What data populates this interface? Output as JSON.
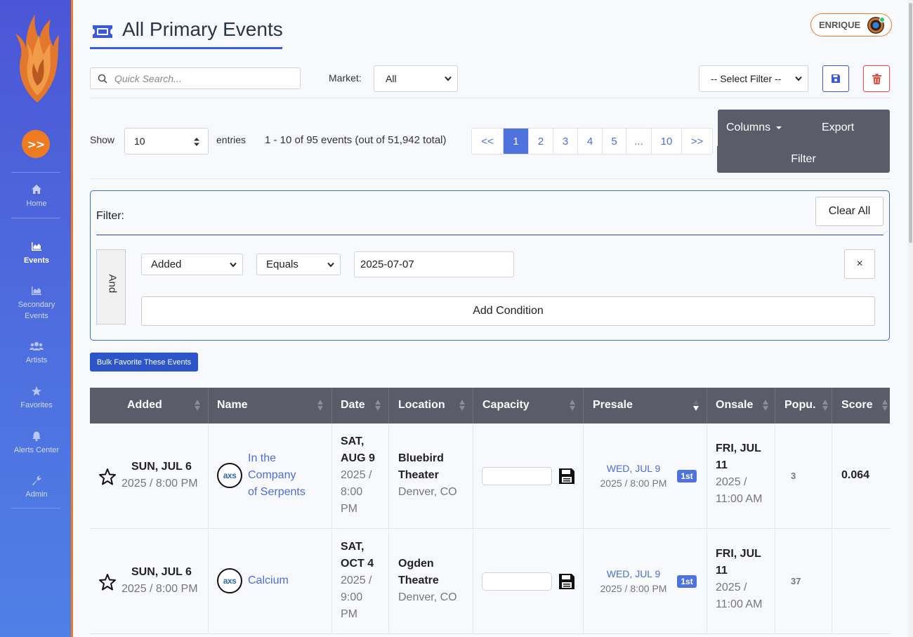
{
  "app": {
    "title": "All Primary Events",
    "user": "ENRIQUE"
  },
  "sidebar": {
    "toggle_glyph": ">>",
    "items": [
      {
        "label": "Home",
        "icon": "home-icon"
      },
      {
        "label": "Events",
        "icon": "chart-area-icon"
      },
      {
        "label": "Secondary Events",
        "icon": "chart-area-icon"
      },
      {
        "label": "Artists",
        "icon": "users-icon"
      },
      {
        "label": "Favorites",
        "icon": "star-icon"
      },
      {
        "label": "Alerts Center",
        "icon": "bell-icon"
      },
      {
        "label": "Admin",
        "icon": "wrench-icon"
      }
    ]
  },
  "toolbar": {
    "search_placeholder": "Quick Search...",
    "market_label": "Market:",
    "market_value": "All",
    "filter_select_value": "-- Select Filter --"
  },
  "listing": {
    "show_label": "Show",
    "entries_value": "10",
    "entries_label": "entries",
    "count_text": "1 - 10 of 95 events (out of 51,942 total)",
    "pages": [
      "<<",
      "1",
      "2",
      "3",
      "4",
      "5",
      "...",
      "10",
      ">>"
    ],
    "active_page": "1",
    "columns_label": "Columns",
    "export_label": "Export",
    "filter_label": "Filter"
  },
  "filter": {
    "title": "Filter:",
    "clear_label": "Clear All",
    "and_label": "And",
    "field_value": "Added",
    "operator_value": "Equals",
    "value": "2025-07-07",
    "remove_label": "×",
    "add_condition_label": "Add Condition"
  },
  "bulk_favorite_label": "Bulk Favorite These Events",
  "table": {
    "headers": [
      "Added",
      "Name",
      "Date",
      "Location",
      "Capacity",
      "Presale",
      "Onsale",
      "Popu.",
      "Score"
    ],
    "rows": [
      {
        "added_day": "SUN, JUL 6",
        "added_time": "2025 / 8:00 PM",
        "logo": "axs",
        "name_lines": [
          "In the",
          "Company",
          "of Serpents"
        ],
        "date_lines": [
          "SAT,",
          "AUG 9"
        ],
        "date_sub_lines": [
          "2025 /",
          "8:00",
          "PM"
        ],
        "location_lines": [
          "Bluebird",
          "Theater"
        ],
        "city": "Denver, CO",
        "presale_day": "WED, JUL 9",
        "presale_time": "2025 / 8:00 PM",
        "presale_badge": "1st",
        "onsale_lines": [
          "FRI, JUL",
          "11"
        ],
        "onsale_sub_lines": [
          "2025 /",
          "11:00 AM"
        ],
        "popularity": "3",
        "score": "0.064"
      },
      {
        "added_day": "SUN, JUL 6",
        "added_time": "2025 / 8:00 PM",
        "logo": "axs",
        "name_lines": [
          "Calcium"
        ],
        "date_lines": [
          "SAT,",
          "OCT 4"
        ],
        "date_sub_lines": [
          "2025 /",
          "9:00",
          "PM"
        ],
        "location_lines": [
          "Ogden",
          "Theatre"
        ],
        "city": "Denver, CO",
        "presale_day": "WED, JUL 9",
        "presale_time": "2025 / 8:00 PM",
        "presale_badge": "1st",
        "onsale_lines": [
          "FRI, JUL",
          "11"
        ],
        "onsale_sub_lines": [
          "2025 /",
          "11:00 AM"
        ],
        "popularity": "37",
        "score": ""
      }
    ]
  },
  "colors": {
    "sidebar_top": "#4b56d6",
    "sidebar_accent": "#ec7a2b",
    "primary": "#4e73df",
    "header_dark": "#5a5c69",
    "danger": "#e74a3b"
  }
}
